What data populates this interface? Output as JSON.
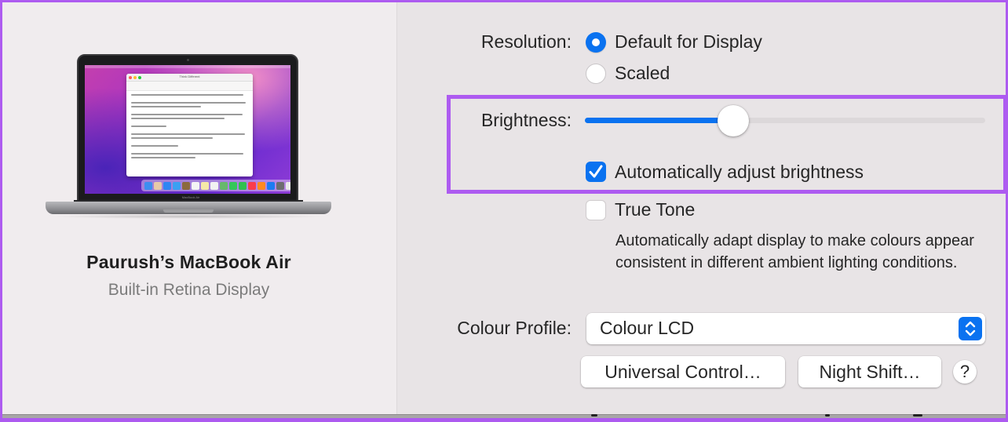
{
  "device": {
    "name": "Paurush’s MacBook Air",
    "subtitle": "Built-in Retina Display",
    "image": {
      "icon": "macbook-air-image",
      "screen_window_title": "Think Different",
      "bezel_label": "MacBook Air"
    }
  },
  "resolution": {
    "label": "Resolution:",
    "options": [
      {
        "label": "Default for Display",
        "selected": true
      },
      {
        "label": "Scaled",
        "selected": false
      }
    ]
  },
  "brightness": {
    "label": "Brightness:",
    "value_percent": 37,
    "auto_adjust": {
      "label": "Automatically adjust brightness",
      "checked": true
    }
  },
  "true_tone": {
    "label": "True Tone",
    "checked": false,
    "description": "Automatically adapt display to make colours appear consistent in different ambient lighting conditions."
  },
  "colour_profile": {
    "label": "Colour Profile:",
    "value": "Colour LCD",
    "icon": "up-down-chevron-icon"
  },
  "buttons": {
    "universal_control": "Universal Control…",
    "night_shift": "Night Shift…",
    "help": "?"
  },
  "colors": {
    "accent": "#0a72f0",
    "highlight_border": "#ad5bf0",
    "background": "#e8e4e6",
    "left_panel": "#f0ecee"
  }
}
